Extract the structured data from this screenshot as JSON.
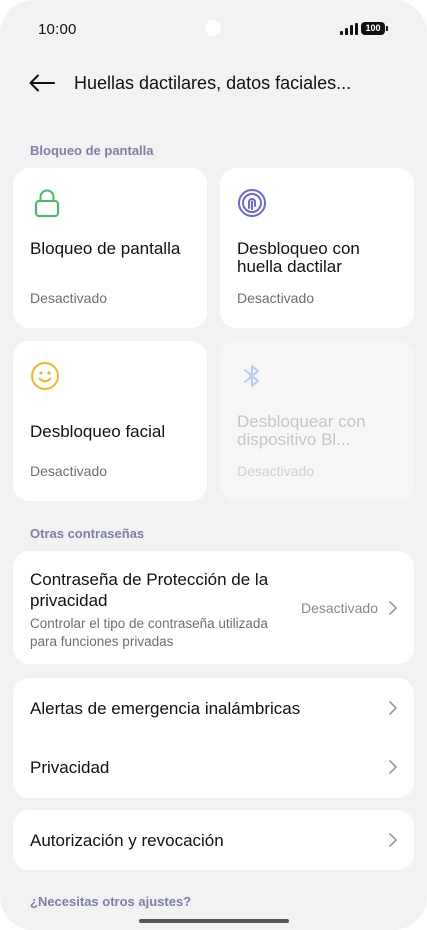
{
  "status_bar": {
    "time": "10:00",
    "battery": "100",
    "icons": [
      "signal-icon",
      "battery-icon"
    ]
  },
  "header": {
    "back_icon": "arrow-left-icon",
    "title": "Huellas dactilares, datos faciales..."
  },
  "sections": {
    "screen_lock": "Bloqueo de pantalla",
    "other_passwords": "Otras contraseñas",
    "need_more": "¿Necesitas otros ajustes?"
  },
  "tiles": [
    {
      "title": "Bloqueo de pantalla",
      "status": "Desactivado",
      "icon": "lock-icon",
      "color": "#3dbf63",
      "enabled": true
    },
    {
      "title": "Desbloqueo con huella dactilar",
      "status": "Desactivado",
      "icon": "fingerprint-icon",
      "color": "#6b67d9",
      "enabled": true
    },
    {
      "title": "Desbloqueo facial",
      "status": "Desactivado",
      "icon": "face-icon",
      "color": "#f1b91d",
      "enabled": true
    },
    {
      "title": "Desbloquear con dispositivo Bl...",
      "status": "Desactivado",
      "icon": "bluetooth-icon",
      "color": "#b9cbf3",
      "enabled": false
    }
  ],
  "privacy_password": {
    "title": "Contraseña de Protección de la privacidad",
    "subtitle": "Controlar el tipo de contraseña utilizada para funciones privadas",
    "value": "Desactivado"
  },
  "list_rows": {
    "emergency_alerts": "Alertas de emergencia inalámbricas",
    "privacy": "Privacidad",
    "authorization": "Autorización y revocación"
  },
  "colors": {
    "background": "#f2f2f2",
    "card": "#ffffff",
    "section_header": "#7c7fa6"
  }
}
